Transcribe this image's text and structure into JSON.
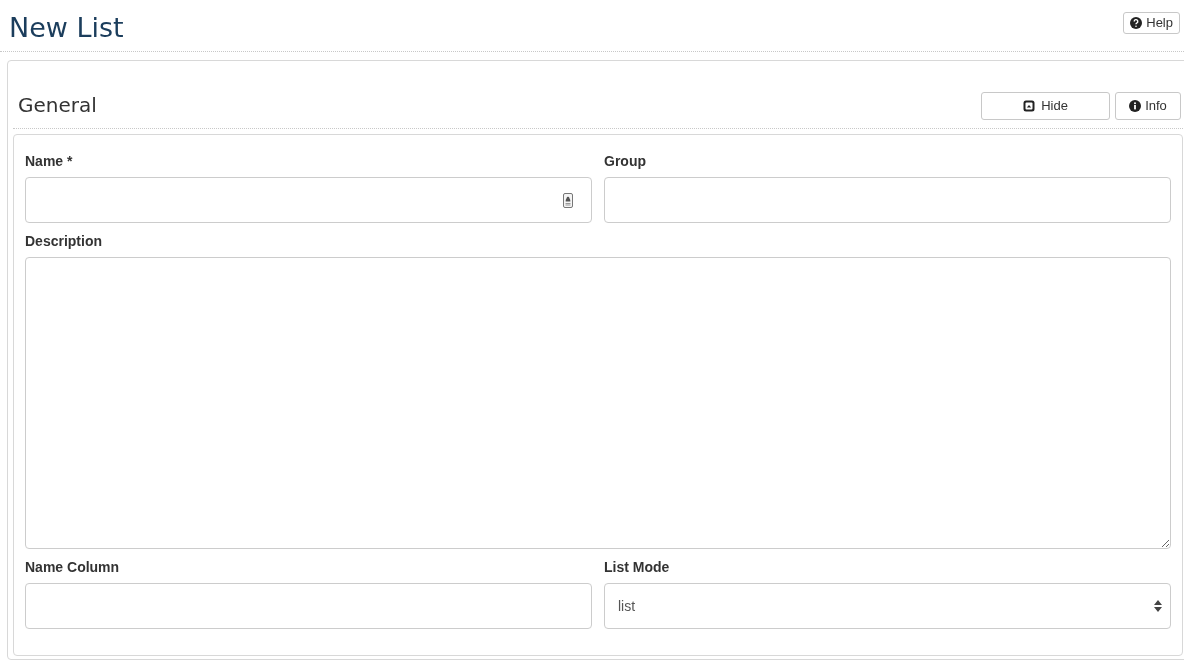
{
  "page": {
    "title": "New List",
    "help_button": "Help"
  },
  "panel": {
    "title": "General",
    "hide_button": "Hide",
    "info_button": "Info"
  },
  "fields": [
    {
      "label": "Name *",
      "kind": "text",
      "contact_icon": true
    },
    {
      "label": "Group",
      "kind": "text",
      "contact_icon": false
    },
    {
      "label": "Description",
      "kind": "textarea"
    },
    {
      "label": "Name Column",
      "kind": "text",
      "contact_icon": false
    },
    {
      "label": "List Mode",
      "kind": "select",
      "value": "list"
    }
  ]
}
